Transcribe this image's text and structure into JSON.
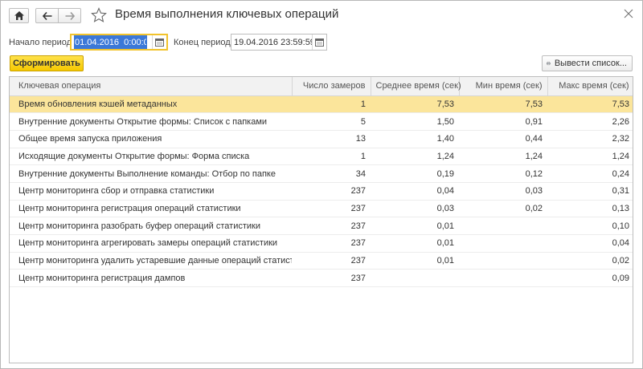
{
  "window": {
    "title": "Время выполнения ключевых операций"
  },
  "period": {
    "start_label": "Начало периода:",
    "start_value": "01.04.2016  0:00:00",
    "end_label": "Конец периода:",
    "end_value": "19.04.2016 23:59:59"
  },
  "toolbar": {
    "generate_label": "Сформировать",
    "export_label": "Вывести список..."
  },
  "table": {
    "columns": [
      "Ключевая операция",
      "Число замеров",
      "Среднее время (сек)",
      "Мин время (сек)",
      "Макс время (сек)"
    ],
    "rows": [
      {
        "operation": "Время обновления кэшей метаданных",
        "count": "1",
        "avg": "7,53",
        "min": "7,53",
        "max": "7,53"
      },
      {
        "operation": "Внутренние документы Открытие формы: Список с папками",
        "count": "5",
        "avg": "1,50",
        "min": "0,91",
        "max": "2,26"
      },
      {
        "operation": "Общее время запуска приложения",
        "count": "13",
        "avg": "1,40",
        "min": "0,44",
        "max": "2,32"
      },
      {
        "operation": "Исходящие документы Открытие формы: Форма списка",
        "count": "1",
        "avg": "1,24",
        "min": "1,24",
        "max": "1,24"
      },
      {
        "operation": "Внутренние документы Выполнение команды: Отбор по папке",
        "count": "34",
        "avg": "0,19",
        "min": "0,12",
        "max": "0,24"
      },
      {
        "operation": "Центр мониторинга сбор и отправка статистики",
        "count": "237",
        "avg": "0,04",
        "min": "0,03",
        "max": "0,31"
      },
      {
        "operation": "Центр мониторинга регистрация операций статистики",
        "count": "237",
        "avg": "0,03",
        "min": "0,02",
        "max": "0,13"
      },
      {
        "operation": "Центр мониторинга разобрать буфер операций статистики",
        "count": "237",
        "avg": "0,01",
        "min": "",
        "max": "0,10"
      },
      {
        "operation": "Центр мониторинга агрегировать замеры операций статистики",
        "count": "237",
        "avg": "0,01",
        "min": "",
        "max": "0,04"
      },
      {
        "operation": "Центр мониторинга удалить устаревшие данные операций статистики",
        "count": "237",
        "avg": "0,01",
        "min": "",
        "max": "0,02"
      },
      {
        "operation": "Центр мониторинга регистрация дампов",
        "count": "237",
        "avg": "",
        "min": "",
        "max": "0,09"
      }
    ],
    "selected_row": 0
  },
  "icons": {
    "home": "home-icon",
    "back": "arrow-left-icon",
    "forward": "arrow-right-icon",
    "favorite": "star-icon",
    "close": "close-icon",
    "calendar": "calendar-icon",
    "export": "printer-list-icon"
  },
  "colors": {
    "accent_yellow": "#f5c800",
    "selected_row": "#fbe59b",
    "focus_border": "#f2c32c",
    "text_selection": "#3b78d8"
  }
}
